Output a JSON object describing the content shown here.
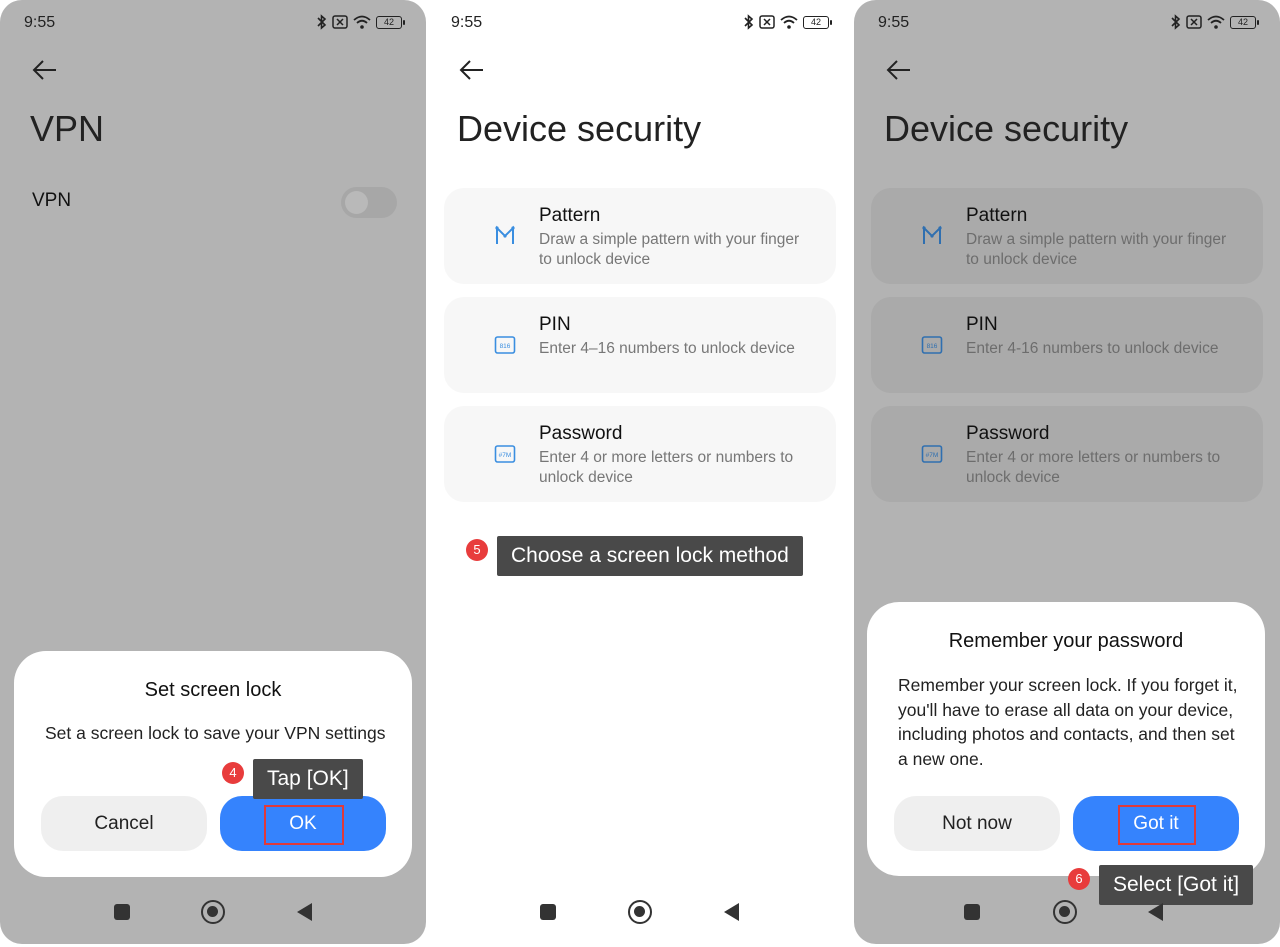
{
  "status_bar": {
    "time": "9:55",
    "battery": "42"
  },
  "screen1": {
    "title": "VPN",
    "vpn_label": "VPN",
    "dialog": {
      "title": "Set screen lock",
      "body": "Set a screen lock to save your VPN settings",
      "cancel_label": "Cancel",
      "ok_label": "OK"
    },
    "step_number": "4",
    "tooltip": "Tap [OK]"
  },
  "screen2": {
    "title": "Device security",
    "options": [
      {
        "title": "Pattern",
        "desc": "Draw a simple pattern with your finger to unlock device",
        "icon": "pattern-icon"
      },
      {
        "title": "PIN",
        "desc": "Enter 4–16 numbers to unlock device",
        "icon": "pin-icon"
      },
      {
        "title": "Password",
        "desc": "Enter 4 or more letters or numbers to unlock device",
        "icon": "password-icon"
      }
    ],
    "step_number": "5",
    "tooltip": "Choose a screen lock method"
  },
  "screen3": {
    "title": "Device security",
    "options": [
      {
        "title": "Pattern",
        "desc": "Draw a simple pattern with your finger to unlock device",
        "icon": "pattern-icon"
      },
      {
        "title": "PIN",
        "desc": "Enter 4-16 numbers to unlock device",
        "icon": "pin-icon"
      },
      {
        "title": "Password",
        "desc": "Enter 4 or more letters or numbers to unlock device",
        "icon": "password-icon"
      }
    ],
    "dialog": {
      "title": "Remember your password",
      "body": "Remember your screen lock. If you forget it, you'll have to erase all data on your device, including photos and contacts, and then set a new one.",
      "not_now_label": "Not now",
      "got_it_label": "Got it"
    },
    "step_number": "6",
    "tooltip": "Select [Got it]"
  },
  "icon_text": {
    "pin": "816",
    "password": "#7M"
  },
  "colors": {
    "accent": "#3583fd",
    "highlight": "#e03a3a",
    "badge": "#e83c3c",
    "tooltip_bg": "#494949",
    "dim_overlay": "#b3b3b3"
  }
}
